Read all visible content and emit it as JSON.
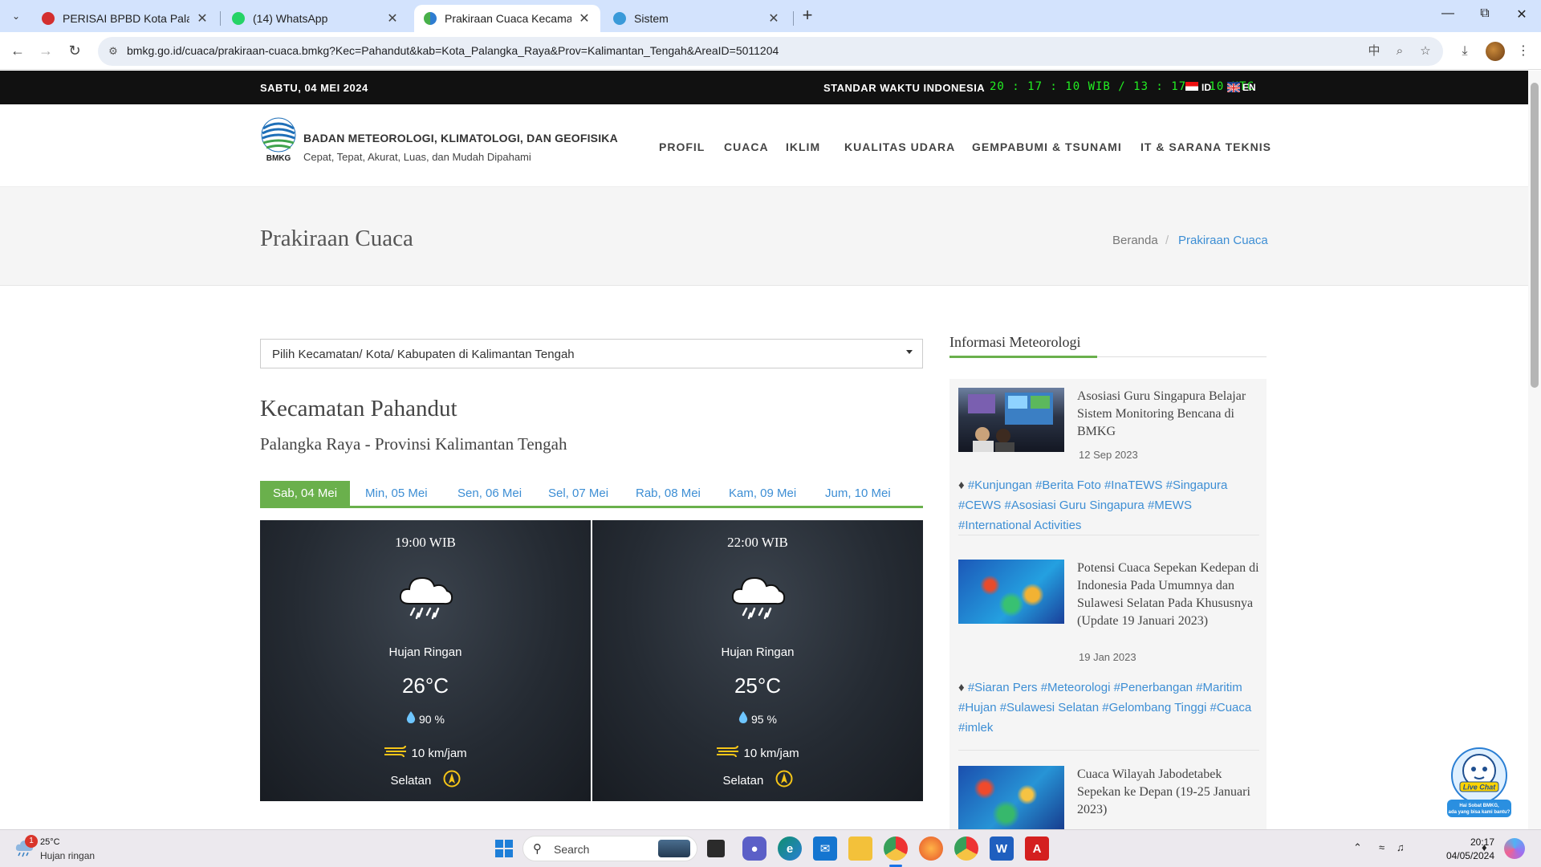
{
  "browser": {
    "tabs": [
      {
        "label": "PERISAI BPBD Kota Palangka Ra",
        "color": "#d32f2f"
      },
      {
        "label": "(14) WhatsApp",
        "color": "#25d366"
      },
      {
        "label": "Prakiraan Cuaca Kecamatan Pa",
        "color": "#2e7dd1"
      },
      {
        "label": "Sistem",
        "color": "#3a9ad9"
      }
    ],
    "url": "bmkg.go.id/cuaca/prakiraan-cuaca.bmkg?Kec=Pahandut&kab=Kota_Palangka_Raya&Prov=Kalimantan_Tengah&AreaID=5011204"
  },
  "topbar": {
    "date": "SABTU, 04 MEI 2024",
    "standard_label": "STANDAR WAKTU INDONESIA",
    "clock": "20 : 17 : 10 WIB / 13 : 17 : 10 UTC",
    "lang_id": "ID",
    "lang_en": "EN"
  },
  "header": {
    "logo_text": "BMKG",
    "org_name": "BADAN METEOROLOGI, KLIMATOLOGI, DAN GEOFISIKA",
    "tagline": "Cepat, Tepat, Akurat, Luas, dan Mudah Dipahami",
    "nav": [
      "PROFIL",
      "CUACA",
      "IKLIM",
      "KUALITAS UDARA",
      "GEMPABUMI & TSUNAMI",
      "IT & SARANA TEKNIS"
    ]
  },
  "title_band": {
    "title": "Prakiraan Cuaca",
    "breadcrumb_home": "Beranda",
    "breadcrumb_sep": "/",
    "breadcrumb_current": "Prakiraan Cuaca"
  },
  "main": {
    "select_value": "Pilih Kecamatan/ Kota/ Kabupaten di Kalimantan Tengah",
    "kecamatan": "Kecamatan Pahandut",
    "province": "Palangka Raya - Provinsi Kalimantan Tengah",
    "day_tabs": [
      "Sab, 04 Mei",
      "Min, 05 Mei",
      "Sen, 06 Mei",
      "Sel, 07 Mei",
      "Rab, 08 Mei",
      "Kam, 09 Mei",
      "Jum, 10 Mei"
    ],
    "forecasts": [
      {
        "time": "19:00 WIB",
        "icon": "light-rain-icon",
        "condition": "Hujan Ringan",
        "temp": "26°C",
        "humidity": "90 %",
        "wind": "10 km/jam",
        "direction": "Selatan"
      },
      {
        "time": "22:00 WIB",
        "icon": "light-rain-icon",
        "condition": "Hujan Ringan",
        "temp": "25°C",
        "humidity": "95 %",
        "wind": "10 km/jam",
        "direction": "Selatan"
      }
    ]
  },
  "sidebar": {
    "title": "Informasi Meteorologi",
    "news": [
      {
        "title": "Asosiasi Guru Singapura Belajar Sistem Monitoring Bencana di BMKG",
        "date": "12 Sep 2023",
        "tags": "#Kunjungan #Berita Foto #InaTEWS #Singapura #CEWS #Asosiasi Guru Singapura #MEWS #International Activities"
      },
      {
        "title": "Potensi Cuaca Sepekan Kedepan di Indonesia Pada Umumnya dan Sulawesi Selatan Pada Khususnya (Update 19 Januari 2023)",
        "date": "19 Jan 2023",
        "tags": "#Siaran Pers #Meteorologi #Penerbangan #Maritim #Hujan #Sulawesi Selatan #Gelombang Tinggi #Cuaca #imlek"
      },
      {
        "title": "Cuaca Wilayah Jabodetabek Sepekan ke Depan (19-25 Januari 2023)"
      }
    ]
  },
  "livechat": {
    "line1": "Live Chat",
    "line2": "Hai Sobat BMKG,",
    "line3": "ada yang bisa kami bantu?"
  },
  "taskbar": {
    "weather_badge": "1",
    "weather_temp": "25°C",
    "weather_cond": "Hujan ringan",
    "search_placeholder": "Search",
    "time": "20:17",
    "date": "04/05/2024"
  },
  "colors": {
    "accent_green": "#6ab04c",
    "link_blue": "#3d8ed4",
    "clock_green": "#22ee22"
  }
}
